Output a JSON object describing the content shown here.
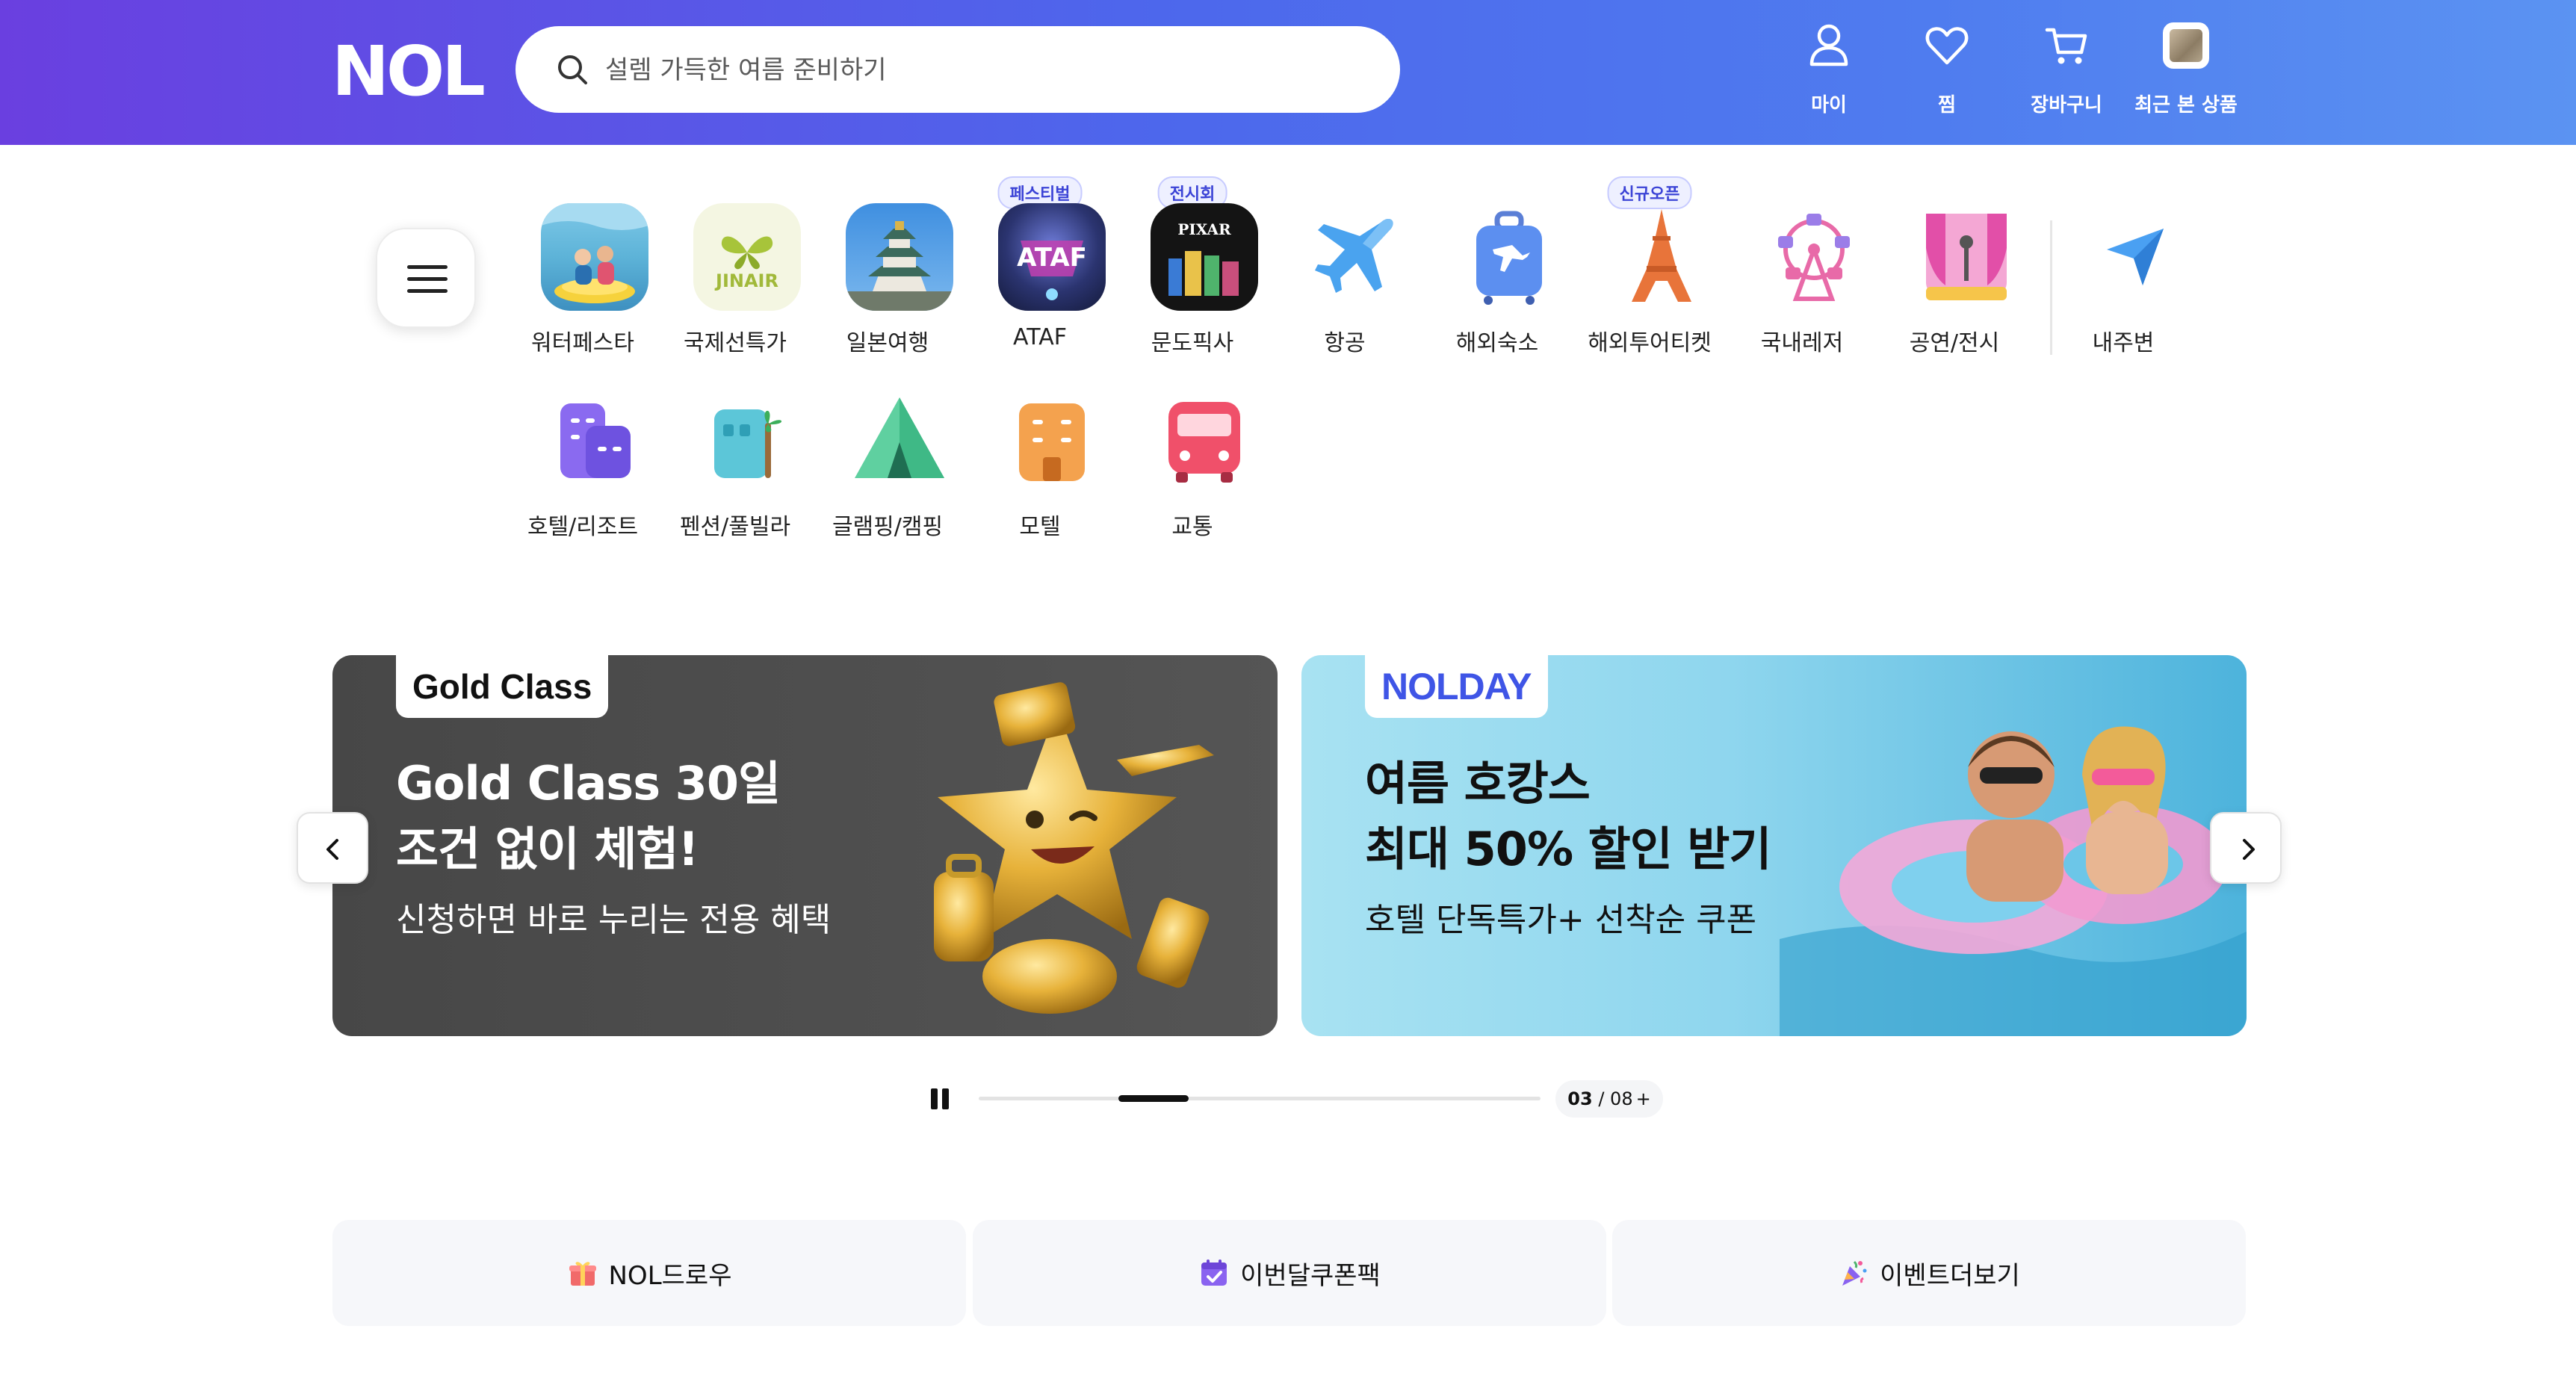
{
  "header": {
    "logo": "NOL",
    "search_placeholder": "설렘 가득한 여름 준비하기",
    "nav": [
      {
        "label": "마이",
        "icon": "person-icon"
      },
      {
        "label": "찜",
        "icon": "heart-icon"
      },
      {
        "label": "장바구니",
        "icon": "cart-icon"
      },
      {
        "label": "최근 본 상품",
        "icon": "recent-thumbnail"
      }
    ]
  },
  "categories": [
    {
      "label": "워터페스타",
      "icon": "water-festa-thumbnail"
    },
    {
      "label": "국제선특가",
      "icon": "jinair-logo"
    },
    {
      "label": "일본여행",
      "icon": "japan-castle-thumbnail"
    },
    {
      "label": "ATAF",
      "badge": "페스티벌",
      "icon": "ataf-festival-thumbnail"
    },
    {
      "label": "문도픽사",
      "badge": "전시회",
      "icon": "pixar-exhibition-thumbnail",
      "tile_text": "PIXAR"
    },
    {
      "label": "항공",
      "icon": "airplane-icon"
    },
    {
      "label": "해외숙소",
      "icon": "suitcase-icon"
    },
    {
      "label": "해외투어티켓",
      "badge": "신규오픈",
      "icon": "eiffel-tower-icon"
    },
    {
      "label": "국내레저",
      "icon": "ferris-wheel-icon"
    },
    {
      "label": "공연/전시",
      "icon": "stage-microphone-icon"
    },
    {
      "label": "내주변",
      "icon": "location-arrow-icon"
    },
    {
      "label": "호텔/리조트",
      "icon": "hotel-building-icon"
    },
    {
      "label": "펜션/풀빌라",
      "icon": "pension-palm-icon"
    },
    {
      "label": "글램핑/캠핑",
      "icon": "tent-icon"
    },
    {
      "label": "모텔",
      "icon": "motel-building-icon"
    },
    {
      "label": "교통",
      "icon": "bus-icon"
    }
  ],
  "banners": [
    {
      "tag": "Gold Class",
      "title_line1": "Gold Class 30일",
      "title_line2": "조건 없이 체험!",
      "subtitle": "신청하면 바로 누리는 전용 혜택",
      "bg": "#4d4d4d"
    },
    {
      "tag": "NOLDAY",
      "title_line1": "여름 호캉스",
      "title_line2": "최대 50% 할인 받기",
      "subtitle": "호텔 단독특가+ 선착순 쿠폰",
      "bg": "#9adbf0"
    }
  ],
  "carousel": {
    "current": "03",
    "total": "08",
    "progress": 0.375,
    "more": "+"
  },
  "shortcuts": [
    {
      "label": "NOL드로우",
      "icon": "gift-icon"
    },
    {
      "label": "이번달쿠폰팩",
      "icon": "calendar-check-icon"
    },
    {
      "label": "이벤트더보기",
      "icon": "party-popper-icon"
    }
  ],
  "colors": {
    "header_start": "#6a3fe0",
    "header_end": "#5b93f2",
    "accent": "#3f55e6"
  }
}
